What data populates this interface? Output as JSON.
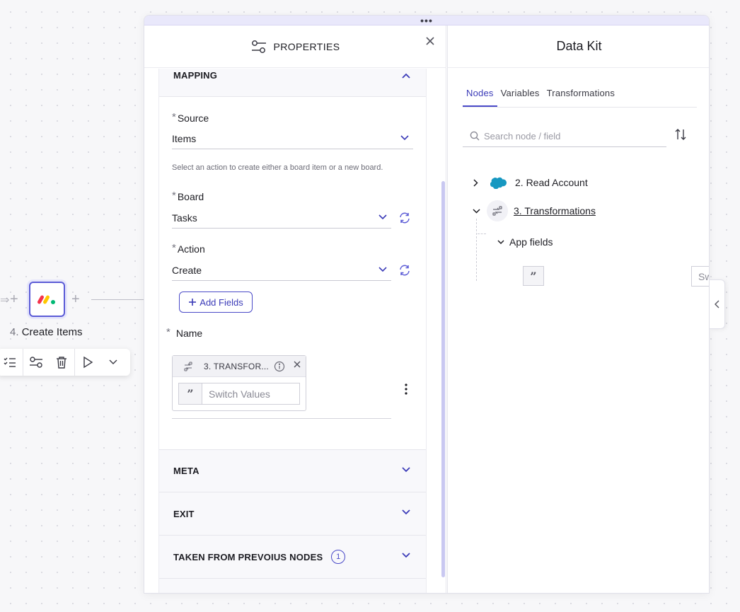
{
  "canvas": {
    "node": {
      "number": "4.",
      "title": "Create Items",
      "icon": "monday-logo-icon",
      "accent": "#5b5bd6"
    },
    "plus_symbol": "+"
  },
  "properties": {
    "title": "PROPERTIES",
    "sections": {
      "mapping": "MAPPING",
      "meta": "META",
      "exit": "EXIT",
      "taken_from_previous": "TAKEN FROM PREVOIUS NODES",
      "taken_count": "1"
    },
    "required_mark": "*",
    "source": {
      "label": "Source",
      "value": "Items",
      "help": "Select an action to create either a board item or a new board."
    },
    "board": {
      "label": "Board",
      "value": "Tasks"
    },
    "action": {
      "label": "Action",
      "value": "Create"
    },
    "add_fields_label": "Add Fields",
    "name_field": {
      "label": "Name",
      "chip_title": "3. TRANSFOR...",
      "value": "Switch Values",
      "quote_glyph": "”"
    }
  },
  "datakit": {
    "title": "Data Kit",
    "tabs": [
      "Nodes",
      "Variables",
      "Transformations"
    ],
    "active_tab": "Nodes",
    "search_placeholder": "Search node / field",
    "tree": {
      "read_account": "2. Read Account",
      "transformations": "3. Transformations",
      "app_fields": "App fields",
      "switch_values": "Switch Values"
    }
  },
  "colors": {
    "accent": "#4a4ac8",
    "drag_bar": "#e9e8fb",
    "salesforce": "#1798c1"
  }
}
